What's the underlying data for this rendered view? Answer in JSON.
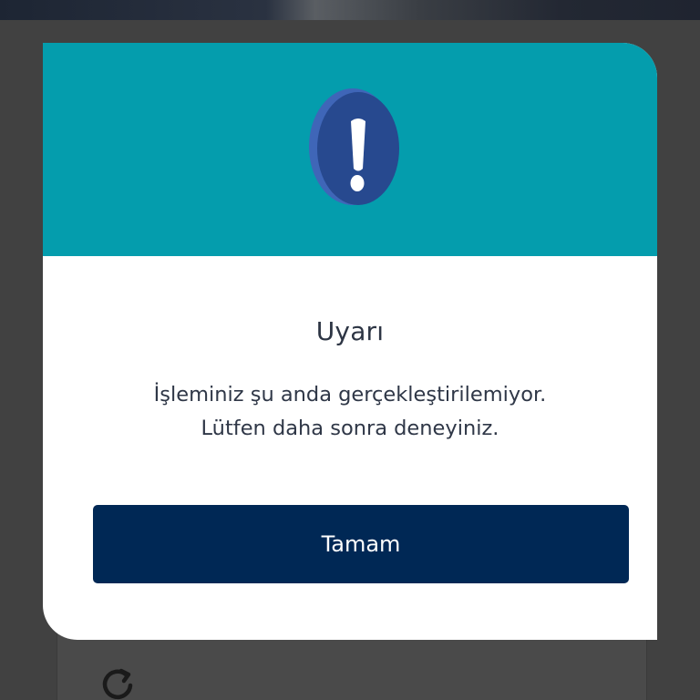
{
  "dialog": {
    "title": "Uyarı",
    "message_line1": "İşleminiz şu anda gerçekleştirilemiyor.",
    "message_line2": "Lütfen daha sonra deneyiniz.",
    "ok_button_label": "Tamam",
    "icon": "exclamation-icon"
  },
  "background": {
    "icon": "refresh-icon"
  },
  "colors": {
    "header": "#049dad",
    "button": "#002855",
    "overlay": "#414141",
    "icon_front": "#27498f",
    "icon_side": "#3f66b8"
  }
}
